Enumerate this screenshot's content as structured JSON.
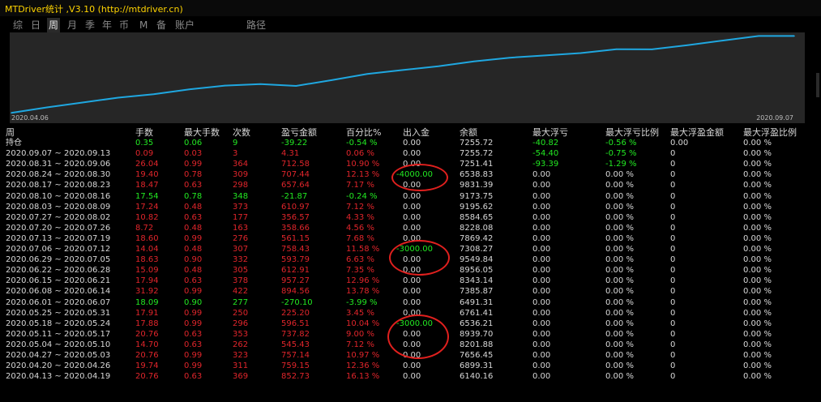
{
  "window": {
    "title": "MTDriver统计 ,V3.10 (http://mtdriver.cn)"
  },
  "tabs": [
    {
      "label": "综",
      "active": false
    },
    {
      "label": "日",
      "active": false
    },
    {
      "label": "周",
      "active": true
    },
    {
      "label": "月",
      "active": false
    },
    {
      "label": "季",
      "active": false
    },
    {
      "label": "年",
      "active": false
    },
    {
      "label": "币",
      "active": false
    },
    {
      "label": "M",
      "active": false
    },
    {
      "label": "备",
      "active": false
    },
    {
      "label": "账户",
      "active": false
    },
    {
      "label": "路径",
      "active": false
    }
  ],
  "chart": {
    "start_label": "2020.04.06",
    "end_label": "2020.09.07",
    "line_color": "#1fa7e0",
    "background": "#262626"
  },
  "chart_data": {
    "type": "line",
    "x": [
      "2020.04.06",
      "2020.04.13",
      "2020.04.20",
      "2020.04.27",
      "2020.05.04",
      "2020.05.11",
      "2020.05.18",
      "2020.05.25",
      "2020.06.01",
      "2020.06.08",
      "2020.06.15",
      "2020.06.22",
      "2020.06.29",
      "2020.07.06",
      "2020.07.13",
      "2020.07.20",
      "2020.07.27",
      "2020.08.03",
      "2020.08.10",
      "2020.08.17",
      "2020.08.24",
      "2020.08.31",
      "2020.09.07"
    ],
    "series": [
      {
        "values": [
          5288,
          6140.16,
          6899.31,
          7656.45,
          8201.88,
          8939.7,
          9536.21,
          9761.41,
          9491.31,
          10385.87,
          11343.14,
          11956.05,
          12549.84,
          13308.27,
          13869.42,
          14228.08,
          14584.65,
          15195.62,
          15173.75,
          15831.39,
          16538.83,
          17251.41,
          17255.72
        ]
      }
    ],
    "xlabel": "",
    "ylabel": "",
    "grid": false
  },
  "columns": [
    "周",
    "手数",
    "最大手数",
    "次数",
    "盈亏金额",
    "百分比%",
    "出入金",
    "余额",
    "最大浮亏",
    "最大浮亏比例",
    "最大浮盈金额",
    "最大浮盈比例"
  ],
  "colors": {
    "pos": "#22e822",
    "neg": "#e0252b",
    "neutral": "#d8d8d8",
    "title": "#ffd400"
  },
  "rows": [
    {
      "cells": [
        "持仓",
        "0.35",
        "0.06",
        "9",
        "-39.22",
        "-0.54 %",
        "0.00",
        "7255.72",
        "-40.82",
        "-0.56 %",
        "0.00",
        "0.00 %"
      ],
      "colors": [
        "w",
        "g",
        "g",
        "g",
        "g",
        "g",
        "w",
        "w",
        "g",
        "g",
        "w",
        "w"
      ]
    },
    {
      "cells": [
        "2020.09.07 ~ 2020.09.13",
        "0.09",
        "0.03",
        "3",
        "4.31",
        "0.06 %",
        "0.00",
        "7255.72",
        "-54.40",
        "-0.75 %",
        "0",
        "0.00 %"
      ],
      "colors": [
        "w",
        "r",
        "r",
        "r",
        "r",
        "r",
        "w",
        "w",
        "g",
        "g",
        "w",
        "w"
      ]
    },
    {
      "cells": [
        "2020.08.31 ~ 2020.09.06",
        "26.04",
        "0.99",
        "364",
        "712.58",
        "10.90 %",
        "0.00",
        "7251.41",
        "-93.39",
        "-1.29 %",
        "0",
        "0.00 %"
      ],
      "colors": [
        "w",
        "r",
        "r",
        "r",
        "r",
        "r",
        "w",
        "w",
        "g",
        "g",
        "w",
        "w"
      ]
    },
    {
      "cells": [
        "2020.08.24 ~ 2020.08.30",
        "19.40",
        "0.78",
        "309",
        "707.44",
        "12.13 %",
        "-4000.00",
        "6538.83",
        "0.00",
        "0.00 %",
        "0",
        "0.00 %"
      ],
      "colors": [
        "w",
        "r",
        "r",
        "r",
        "r",
        "r",
        "g",
        "w",
        "w",
        "w",
        "w",
        "w"
      ]
    },
    {
      "cells": [
        "2020.08.17 ~ 2020.08.23",
        "18.47",
        "0.63",
        "298",
        "657.64",
        "7.17 %",
        "0.00",
        "9831.39",
        "0.00",
        "0.00 %",
        "0",
        "0.00 %"
      ],
      "colors": [
        "w",
        "r",
        "r",
        "r",
        "r",
        "r",
        "w",
        "w",
        "w",
        "w",
        "w",
        "w"
      ]
    },
    {
      "cells": [
        "2020.08.10 ~ 2020.08.16",
        "17.54",
        "0.78",
        "348",
        "-21.87",
        "-0.24 %",
        "0.00",
        "9173.75",
        "0.00",
        "0.00 %",
        "0",
        "0.00 %"
      ],
      "colors": [
        "w",
        "g",
        "g",
        "g",
        "g",
        "g",
        "w",
        "w",
        "w",
        "w",
        "w",
        "w"
      ]
    },
    {
      "cells": [
        "2020.08.03 ~ 2020.08.09",
        "17.24",
        "0.48",
        "373",
        "610.97",
        "7.12 %",
        "0.00",
        "9195.62",
        "0.00",
        "0.00 %",
        "0",
        "0.00 %"
      ],
      "colors": [
        "w",
        "r",
        "r",
        "r",
        "r",
        "r",
        "w",
        "w",
        "w",
        "w",
        "w",
        "w"
      ]
    },
    {
      "cells": [
        "2020.07.27 ~ 2020.08.02",
        "10.82",
        "0.63",
        "177",
        "356.57",
        "4.33 %",
        "0.00",
        "8584.65",
        "0.00",
        "0.00 %",
        "0",
        "0.00 %"
      ],
      "colors": [
        "w",
        "r",
        "r",
        "r",
        "r",
        "r",
        "w",
        "w",
        "w",
        "w",
        "w",
        "w"
      ]
    },
    {
      "cells": [
        "2020.07.20 ~ 2020.07.26",
        "8.72",
        "0.48",
        "163",
        "358.66",
        "4.56 %",
        "0.00",
        "8228.08",
        "0.00",
        "0.00 %",
        "0",
        "0.00 %"
      ],
      "colors": [
        "w",
        "r",
        "r",
        "r",
        "r",
        "r",
        "w",
        "w",
        "w",
        "w",
        "w",
        "w"
      ]
    },
    {
      "cells": [
        "2020.07.13 ~ 2020.07.19",
        "18.60",
        "0.99",
        "276",
        "561.15",
        "7.68 %",
        "0.00",
        "7869.42",
        "0.00",
        "0.00 %",
        "0",
        "0.00 %"
      ],
      "colors": [
        "w",
        "r",
        "r",
        "r",
        "r",
        "r",
        "w",
        "w",
        "w",
        "w",
        "w",
        "w"
      ]
    },
    {
      "cells": [
        "2020.07.06 ~ 2020.07.12",
        "14.04",
        "0.48",
        "307",
        "758.43",
        "11.58 %",
        "-3000.00",
        "7308.27",
        "0.00",
        "0.00 %",
        "0",
        "0.00 %"
      ],
      "colors": [
        "w",
        "r",
        "r",
        "r",
        "r",
        "r",
        "g",
        "w",
        "w",
        "w",
        "w",
        "w"
      ]
    },
    {
      "cells": [
        "2020.06.29 ~ 2020.07.05",
        "18.63",
        "0.90",
        "332",
        "593.79",
        "6.63 %",
        "0.00",
        "9549.84",
        "0.00",
        "0.00 %",
        "0",
        "0.00 %"
      ],
      "colors": [
        "w",
        "r",
        "r",
        "r",
        "r",
        "r",
        "w",
        "w",
        "w",
        "w",
        "w",
        "w"
      ]
    },
    {
      "cells": [
        "2020.06.22 ~ 2020.06.28",
        "15.09",
        "0.48",
        "305",
        "612.91",
        "7.35 %",
        "0.00",
        "8956.05",
        "0.00",
        "0.00 %",
        "0",
        "0.00 %"
      ],
      "colors": [
        "w",
        "r",
        "r",
        "r",
        "r",
        "r",
        "w",
        "w",
        "w",
        "w",
        "w",
        "w"
      ]
    },
    {
      "cells": [
        "2020.06.15 ~ 2020.06.21",
        "17.94",
        "0.63",
        "378",
        "957.27",
        "12.96 %",
        "0.00",
        "8343.14",
        "0.00",
        "0.00 %",
        "0",
        "0.00 %"
      ],
      "colors": [
        "w",
        "r",
        "r",
        "r",
        "r",
        "r",
        "w",
        "w",
        "w",
        "w",
        "w",
        "w"
      ]
    },
    {
      "cells": [
        "2020.06.08 ~ 2020.06.14",
        "31.92",
        "0.99",
        "422",
        "894.56",
        "13.78 %",
        "0.00",
        "7385.87",
        "0.00",
        "0.00 %",
        "0",
        "0.00 %"
      ],
      "colors": [
        "w",
        "r",
        "r",
        "r",
        "r",
        "r",
        "w",
        "w",
        "w",
        "w",
        "w",
        "w"
      ]
    },
    {
      "cells": [
        "2020.06.01 ~ 2020.06.07",
        "18.09",
        "0.90",
        "277",
        "-270.10",
        "-3.99 %",
        "0.00",
        "6491.31",
        "0.00",
        "0.00 %",
        "0",
        "0.00 %"
      ],
      "colors": [
        "w",
        "g",
        "g",
        "g",
        "g",
        "g",
        "w",
        "w",
        "w",
        "w",
        "w",
        "w"
      ]
    },
    {
      "cells": [
        "2020.05.25 ~ 2020.05.31",
        "17.91",
        "0.99",
        "250",
        "225.20",
        "3.45 %",
        "0.00",
        "6761.41",
        "0.00",
        "0.00 %",
        "0",
        "0.00 %"
      ],
      "colors": [
        "w",
        "r",
        "r",
        "r",
        "r",
        "r",
        "w",
        "w",
        "w",
        "w",
        "w",
        "w"
      ]
    },
    {
      "cells": [
        "2020.05.18 ~ 2020.05.24",
        "17.88",
        "0.99",
        "296",
        "596.51",
        "10.04 %",
        "-3000.00",
        "6536.21",
        "0.00",
        "0.00 %",
        "0",
        "0.00 %"
      ],
      "colors": [
        "w",
        "r",
        "r",
        "r",
        "r",
        "r",
        "g",
        "w",
        "w",
        "w",
        "w",
        "w"
      ]
    },
    {
      "cells": [
        "2020.05.11 ~ 2020.05.17",
        "20.76",
        "0.63",
        "353",
        "737.82",
        "9.00 %",
        "0.00",
        "8939.70",
        "0.00",
        "0.00 %",
        "0",
        "0.00 %"
      ],
      "colors": [
        "w",
        "r",
        "r",
        "r",
        "r",
        "r",
        "w",
        "w",
        "w",
        "w",
        "w",
        "w"
      ]
    },
    {
      "cells": [
        "2020.05.04 ~ 2020.05.10",
        "14.70",
        "0.63",
        "262",
        "545.43",
        "7.12 %",
        "0.00",
        "8201.88",
        "0.00",
        "0.00 %",
        "0",
        "0.00 %"
      ],
      "colors": [
        "w",
        "r",
        "r",
        "r",
        "r",
        "r",
        "w",
        "w",
        "w",
        "w",
        "w",
        "w"
      ]
    },
    {
      "cells": [
        "2020.04.27 ~ 2020.05.03",
        "20.76",
        "0.99",
        "323",
        "757.14",
        "10.97 %",
        "0.00",
        "7656.45",
        "0.00",
        "0.00 %",
        "0",
        "0.00 %"
      ],
      "colors": [
        "w",
        "r",
        "r",
        "r",
        "r",
        "r",
        "w",
        "w",
        "w",
        "w",
        "w",
        "w"
      ]
    },
    {
      "cells": [
        "2020.04.20 ~ 2020.04.26",
        "19.74",
        "0.99",
        "311",
        "759.15",
        "12.36 %",
        "0.00",
        "6899.31",
        "0.00",
        "0.00 %",
        "0",
        "0.00 %"
      ],
      "colors": [
        "w",
        "r",
        "r",
        "r",
        "r",
        "r",
        "w",
        "w",
        "w",
        "w",
        "w",
        "w"
      ]
    },
    {
      "cells": [
        "2020.04.13 ~ 2020.04.19",
        "20.76",
        "0.63",
        "369",
        "852.73",
        "16.13 %",
        "0.00",
        "6140.16",
        "0.00",
        "0.00 %",
        "0",
        "0.00 %"
      ],
      "colors": [
        "w",
        "r",
        "r",
        "r",
        "r",
        "r",
        "w",
        "w",
        "w",
        "w",
        "w",
        "w"
      ]
    }
  ]
}
